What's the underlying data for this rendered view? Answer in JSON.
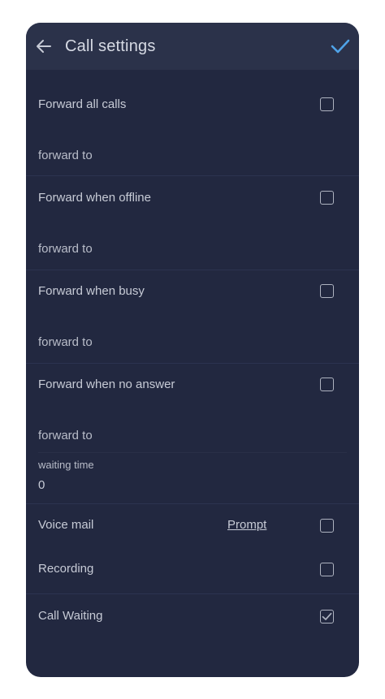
{
  "header": {
    "title": "Call settings"
  },
  "forward_all": {
    "label": "Forward all calls",
    "target_label": "forward to",
    "checked": false
  },
  "forward_offline": {
    "label": "Forward when offline",
    "target_label": "forward to",
    "checked": false
  },
  "forward_busy": {
    "label": "Forward when busy",
    "target_label": "forward to",
    "checked": false
  },
  "forward_no_answer": {
    "label": "Forward when no answer",
    "target_label": "forward to",
    "waiting_time_label": "waiting time",
    "waiting_time_value": "0",
    "checked": false
  },
  "voice_mail": {
    "label": "Voice mail",
    "link_label": "Prompt",
    "checked": false
  },
  "recording": {
    "label": "Recording",
    "checked": false
  },
  "call_waiting": {
    "label": "Call Waiting",
    "checked": true
  },
  "colors": {
    "background": "#222840",
    "header": "#2b324a",
    "accent": "#4fa3e8",
    "text": "#c7cbd6"
  }
}
